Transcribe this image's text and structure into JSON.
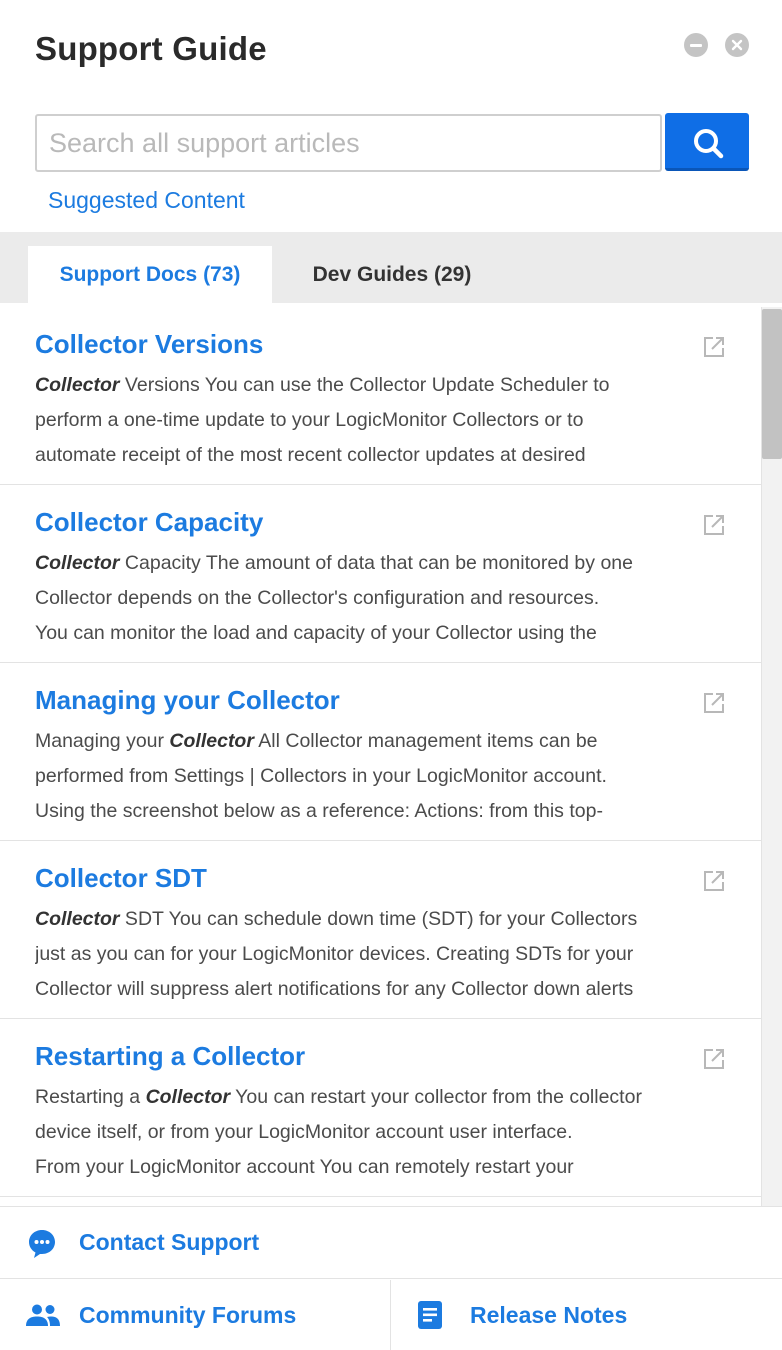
{
  "header": {
    "title": "Support Guide",
    "minimize_icon": "minimize-icon",
    "close_icon": "close-icon"
  },
  "search": {
    "placeholder": "Search all support articles",
    "value": "",
    "button_icon": "search-icon"
  },
  "suggested_link": "Suggested Content",
  "tabs": [
    {
      "label": "Support Docs (73)",
      "active": true
    },
    {
      "label": "Dev Guides (29)",
      "active": false
    }
  ],
  "articles": [
    {
      "title": "Collector Versions",
      "lines": [
        {
          "pre": "",
          "em": "Collector",
          "post": " Versions You can use the Collector Update Scheduler to"
        },
        {
          "pre": "perform a one-time update to your LogicMonitor Collectors or to",
          "em": "",
          "post": ""
        },
        {
          "pre": "automate receipt of the most recent collector updates at desired",
          "em": "",
          "post": ""
        }
      ]
    },
    {
      "title": "Collector Capacity",
      "lines": [
        {
          "pre": "",
          "em": "Collector",
          "post": " Capacity The amount of data that can be monitored by one"
        },
        {
          "pre": "Collector depends on the Collector's configuration and resources.",
          "em": "",
          "post": ""
        },
        {
          "pre": " You can monitor the load and capacity of your Collector using the",
          "em": "",
          "post": ""
        }
      ]
    },
    {
      "title": "Managing your Collector",
      "lines": [
        {
          "pre": "Managing your ",
          "em": "Collector",
          "post": " All Collector management items can be"
        },
        {
          "pre": "performed from Settings | Collectors in your LogicMonitor account.",
          "em": "",
          "post": ""
        },
        {
          "pre": "Using the screenshot below as a reference:  Actions: from this top-",
          "em": "",
          "post": ""
        }
      ]
    },
    {
      "title": "Collector SDT",
      "lines": [
        {
          "pre": "",
          "em": "Collector",
          "post": " SDT You can schedule down time (SDT) for your Collectors"
        },
        {
          "pre": "just as you can for your LogicMonitor devices.  Creating SDTs for your",
          "em": "",
          "post": ""
        },
        {
          "pre": "Collector will suppress alert notifications for any Collector down alerts",
          "em": "",
          "post": ""
        }
      ]
    },
    {
      "title": "Restarting a Collector",
      "lines": [
        {
          "pre": "Restarting a ",
          "em": "Collector",
          "post": " You can restart your collector from the collector"
        },
        {
          "pre": "device itself, or from your LogicMonitor account user interface.",
          "em": "",
          "post": ""
        },
        {
          "pre": "From your LogicMonitor account You can remotely restart your",
          "em": "",
          "post": ""
        }
      ]
    }
  ],
  "footer": {
    "contact": {
      "label": "Contact Support",
      "icon": "chat-bubble-icon"
    },
    "forums": {
      "label": "Community Forums",
      "icon": "people-icon"
    },
    "notes": {
      "label": "Release Notes",
      "icon": "document-icon"
    }
  },
  "colors": {
    "accent": "#1c7be0",
    "search_button": "#0f6ee6",
    "tabbar_bg": "#ebebeb"
  }
}
